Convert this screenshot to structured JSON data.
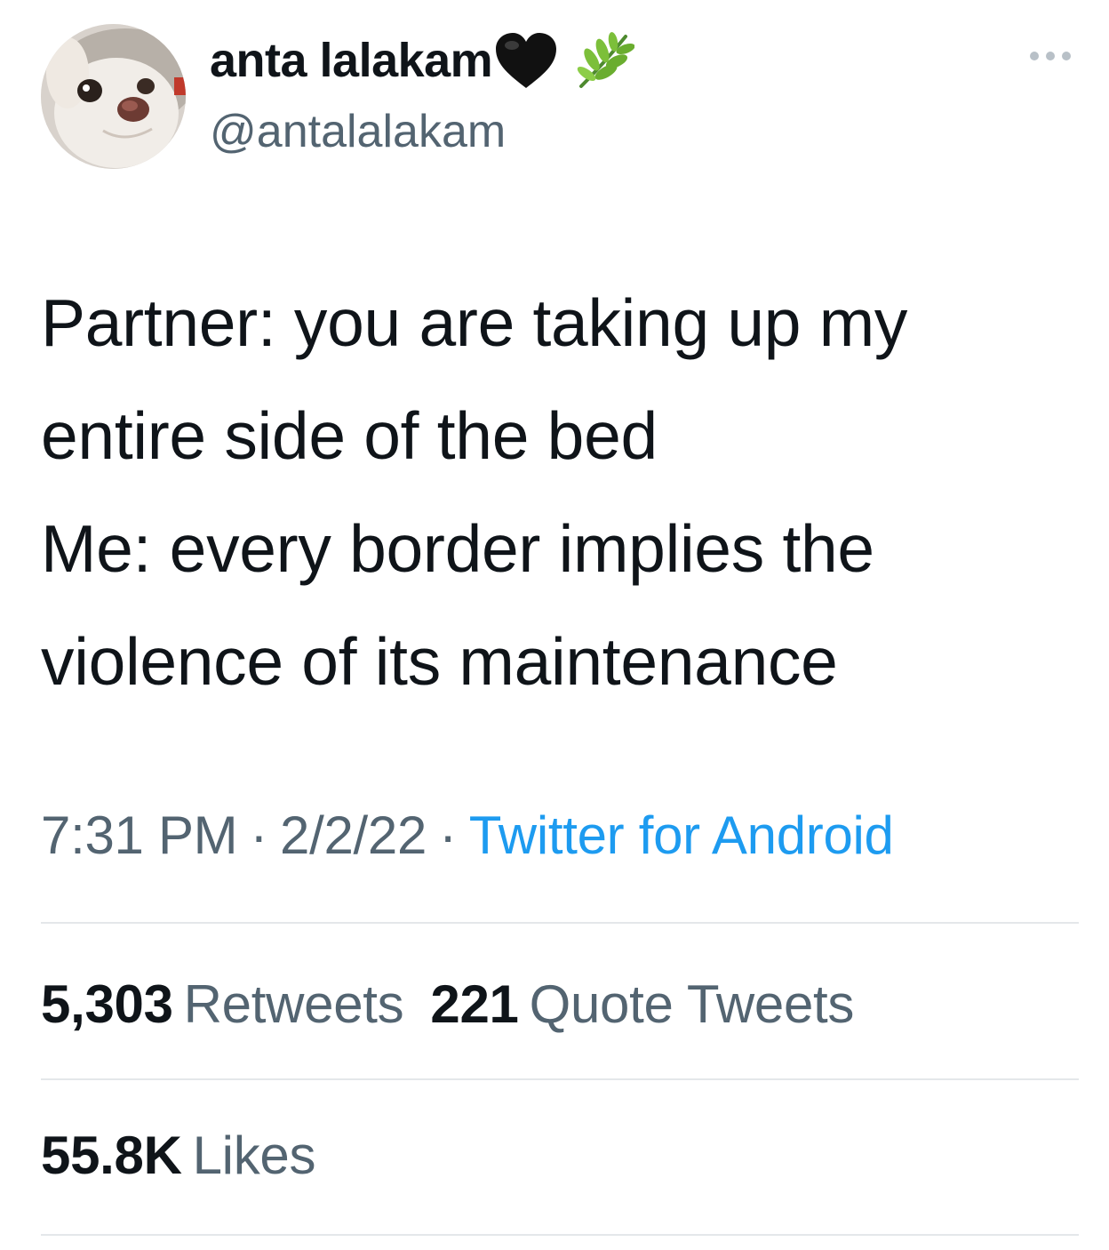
{
  "user": {
    "display_name": "anta lalakam",
    "handle": "@antalalakam",
    "avatar_icon": "chihuahua-avatar",
    "name_emojis": [
      "black-heart-icon",
      "herb-icon"
    ]
  },
  "tweet": {
    "lines": [
      "Partner: you are taking up my",
      "entire side of the bed",
      "Me: every border implies the",
      "violence of its maintenance"
    ]
  },
  "meta": {
    "time": "7:31 PM",
    "separator": "·",
    "date": "2/2/22",
    "source": "Twitter for Android"
  },
  "stats": {
    "retweets_count": "5,303",
    "retweets_label": "Retweets",
    "quotes_count": "221",
    "quotes_label": "Quote Tweets",
    "likes_count": "55.8K",
    "likes_label": "Likes"
  },
  "colors": {
    "text": "#0f1419",
    "secondary": "#536471",
    "link": "#1d9bf0",
    "divider": "#e4e7ea"
  }
}
